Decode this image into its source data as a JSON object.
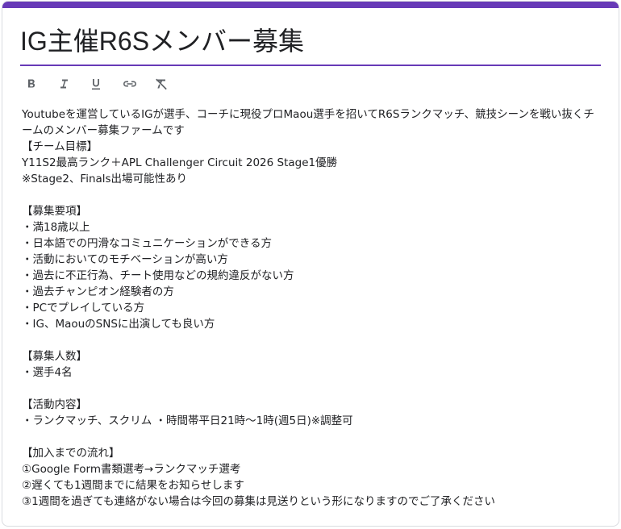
{
  "form": {
    "title": "IG主催R6Sメンバー募集",
    "accent_color": "#673ab7"
  },
  "toolbar": {
    "items": [
      {
        "name": "bold-icon",
        "label": "B"
      },
      {
        "name": "italic-icon",
        "label": "I"
      },
      {
        "name": "underline-icon",
        "label": "U"
      },
      {
        "name": "link-icon",
        "label": ""
      },
      {
        "name": "clear-format-icon",
        "label": ""
      }
    ]
  },
  "description": {
    "lines": [
      "Youtubeを運営しているIGが選手、コーチに現役プロMaou選手を招いてR6Sランクマッチ、競技シーンを戦い抜くチームのメンバー募集ファームです",
      "【チーム目標】",
      "Y11S2最高ランク＋APL Challenger Circuit 2026 Stage1優勝",
      "※Stage2、Finals出場可能性あり",
      "",
      "【募集要項】",
      "・満18歳以上",
      "・日本語での円滑なコミュニケーションができる方",
      "・活動においてのモチベーションが高い方",
      "・過去に不正行為、チート使用などの規約違反がない方",
      "・過去チャンピオン経験者の方",
      "・PCでプレイしている方",
      "・IG、MaouのSNSに出演しても良い方",
      "",
      "【募集人数】",
      "・選手4名",
      "",
      "【活動内容】",
      "・ランクマッチ、スクリム ・時間帯平日21時〜1時(週5日)※調整可",
      "",
      "【加入までの流れ】",
      "①Google Form書類選考→ランクマッチ選考",
      "②遅くても1週間までに結果をお知らせします",
      "③1週間を過ぎても連絡がない場合は今回の募集は見送りという形になりますのでご了承ください"
    ]
  }
}
